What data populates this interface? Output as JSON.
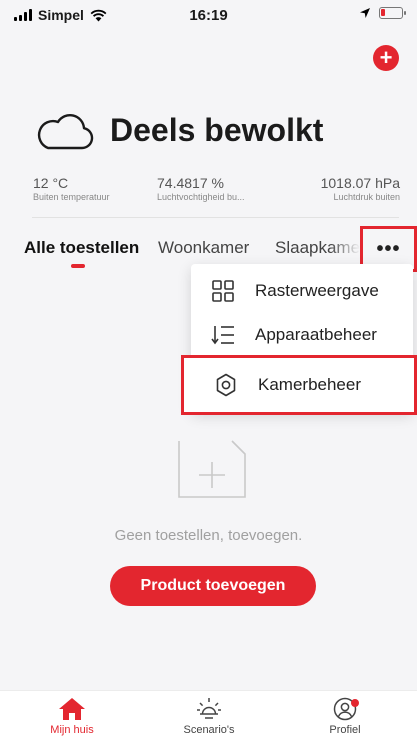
{
  "status_bar": {
    "carrier": "Simpel",
    "time": "16:19"
  },
  "colors": {
    "accent": "#e3262f",
    "background": "#f5f5f7"
  },
  "weather": {
    "title": "Deels bewolkt",
    "icon": "cloud-icon"
  },
  "stats": [
    {
      "value": "12 °C",
      "label": "Buiten temperatuur"
    },
    {
      "value": "74.4817 %",
      "label": "Luchtvochtigheid bu..."
    },
    {
      "value": "1018.07 hPa",
      "label": "Luchtdruk buiten"
    }
  ],
  "tabs": [
    {
      "label": "Alle toestellen",
      "active": true
    },
    {
      "label": "Woonkamer",
      "active": false
    },
    {
      "label": "Slaapkame",
      "active": false
    }
  ],
  "more_button": {
    "label": "•••"
  },
  "menu": {
    "items": [
      {
        "label": "Rasterweergave",
        "icon": "grid-icon"
      },
      {
        "label": "Apparaatbeheer",
        "icon": "sort-list-icon"
      },
      {
        "label": "Kamerbeheer",
        "icon": "settings-icon"
      }
    ]
  },
  "empty_state": {
    "text": "Geen toestellen, toevoegen.",
    "button": "Product toevoegen"
  },
  "nav": [
    {
      "label": "Mijn huis",
      "icon": "home-icon",
      "active": true
    },
    {
      "label": "Scenario's",
      "icon": "sun-icon",
      "active": false
    },
    {
      "label": "Profiel",
      "icon": "profile-icon",
      "active": false
    }
  ]
}
